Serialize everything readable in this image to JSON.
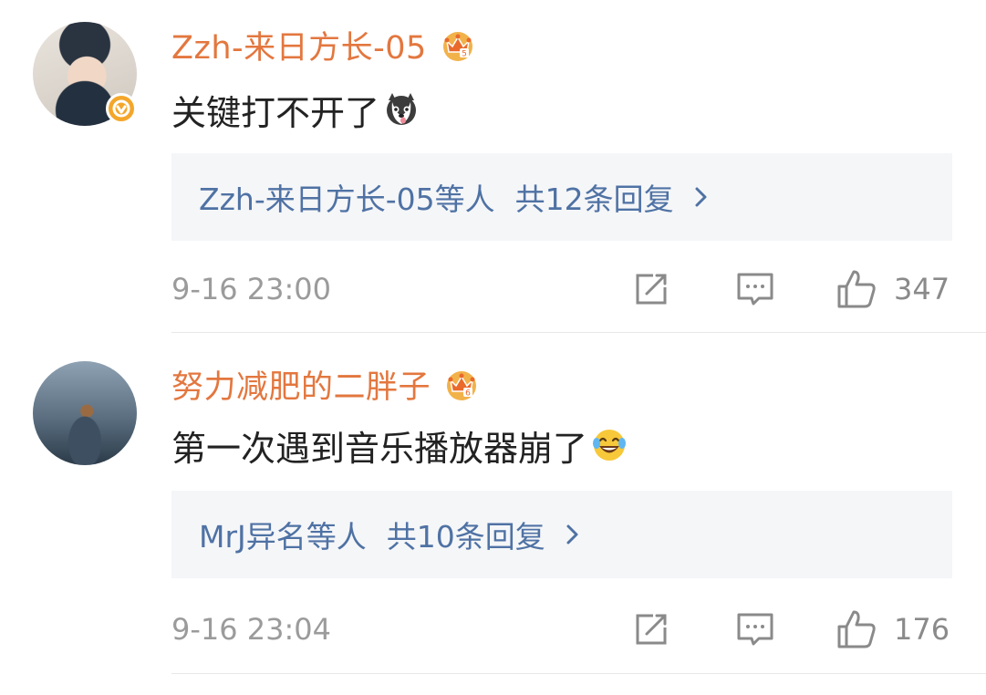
{
  "colors": {
    "username": "#e3773f",
    "reply_link": "#4f72a4",
    "meta": "#9b9b9b",
    "reply_bg": "#f5f6f8",
    "verified_badge": "#f4a62a"
  },
  "comments": [
    {
      "username": "Zzh-来日方长-05",
      "badge_icon": "crown-vip-icon",
      "verified": true,
      "text": "关键打不开了",
      "emoji": "husky-dog-emoji",
      "replies": {
        "users": "Zzh-来日方长-05等人",
        "count_label": "共12条回复"
      },
      "timestamp": "9-16 23:00",
      "likes": "347"
    },
    {
      "username": "努力减肥的二胖子",
      "badge_icon": "crown-vip-icon",
      "verified": false,
      "text": "第一次遇到音乐播放器崩了",
      "emoji": "laughing-tears-emoji",
      "replies": {
        "users": "MrJ异名等人",
        "count_label": "共10条回复"
      },
      "timestamp": "9-16 23:04",
      "likes": "176"
    }
  ]
}
